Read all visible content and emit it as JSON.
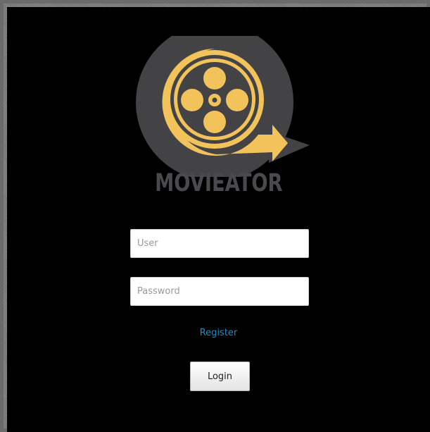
{
  "app": {
    "brand": "MOVIEATOR",
    "logo_icon": "film-reel-icon",
    "colors": {
      "reel": "#f2c25b",
      "badge": "#434346",
      "brand_text": "#4a4a4e",
      "link": "#1e8fc6",
      "background": "#000000"
    }
  },
  "form": {
    "user_placeholder": "User",
    "password_placeholder": "Password",
    "register_label": "Register",
    "login_label": "Login"
  }
}
